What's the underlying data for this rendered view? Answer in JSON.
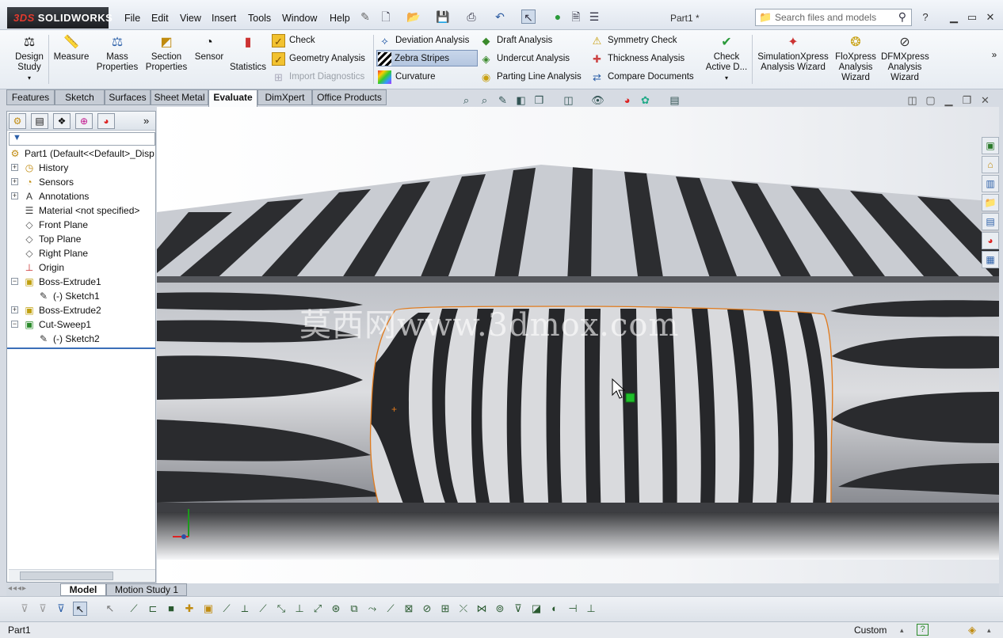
{
  "app": {
    "brand_prefix": "3DS",
    "brand": "SOLIDWORKS",
    "doc_title": "Part1 *"
  },
  "menu": [
    "File",
    "Edit",
    "View",
    "Insert",
    "Tools",
    "Window",
    "Help"
  ],
  "search": {
    "placeholder": "Search files and models"
  },
  "commands": {
    "design_study": "Design Study",
    "measure": "Measure",
    "mass_properties": "Mass Properties",
    "section_properties": "Section Properties",
    "sensor": "Sensor",
    "statistics": "Statistics",
    "check": "Check",
    "geometry_analysis": "Geometry Analysis",
    "import_diagnostics": "Import Diagnostics",
    "deviation_analysis": "Deviation Analysis",
    "zebra_stripes": "Zebra Stripes",
    "curvature": "Curvature",
    "draft_analysis": "Draft Analysis",
    "undercut_analysis": "Undercut Analysis",
    "parting_line_analysis": "Parting Line Analysis",
    "symmetry_check": "Symmetry Check",
    "thickness_analysis": "Thickness Analysis",
    "compare_documents": "Compare Documents",
    "check_active": "Check Active D...",
    "simulationxpress": "SimulationXpress Analysis Wizard",
    "floxpress": "FloXpress Analysis Wizard",
    "dfmxpress": "DFMXpress Analysis Wizard"
  },
  "tabs": [
    "Features",
    "Sketch",
    "Surfaces",
    "Sheet Metal",
    "Evaluate",
    "DimXpert",
    "Office Products"
  ],
  "active_tab": "Evaluate",
  "tree": [
    {
      "label": "Part1  (Default<<Default>_Disp",
      "icon": "part-icon",
      "level": 0
    },
    {
      "label": "History",
      "icon": "history-icon",
      "level": 1
    },
    {
      "label": "Sensors",
      "icon": "sensor-icon",
      "level": 1
    },
    {
      "label": "Annotations",
      "icon": "annotations-icon",
      "level": 1
    },
    {
      "label": "Material <not specified>",
      "icon": "material-icon",
      "level": 1
    },
    {
      "label": "Front Plane",
      "icon": "plane-icon",
      "level": 1
    },
    {
      "label": "Top Plane",
      "icon": "plane-icon",
      "level": 1
    },
    {
      "label": "Right Plane",
      "icon": "plane-icon",
      "level": 1
    },
    {
      "label": "Origin",
      "icon": "origin-icon",
      "level": 1
    },
    {
      "label": "Boss-Extrude1",
      "icon": "extrude-icon",
      "level": 1
    },
    {
      "label": "(-) Sketch1",
      "icon": "sketch-icon",
      "level": 2
    },
    {
      "label": "Boss-Extrude2",
      "icon": "extrude-icon",
      "level": 1
    },
    {
      "label": "Cut-Sweep1",
      "icon": "sweep-icon",
      "level": 1
    },
    {
      "label": "(-) Sketch2",
      "icon": "sketch-icon",
      "level": 2
    }
  ],
  "viewport": {
    "watermark": "莫西网www.3dmox.com"
  },
  "bottom_tabs": [
    "Model",
    "Motion Study 1"
  ],
  "status": {
    "left": "Part1",
    "units": "Custom"
  }
}
